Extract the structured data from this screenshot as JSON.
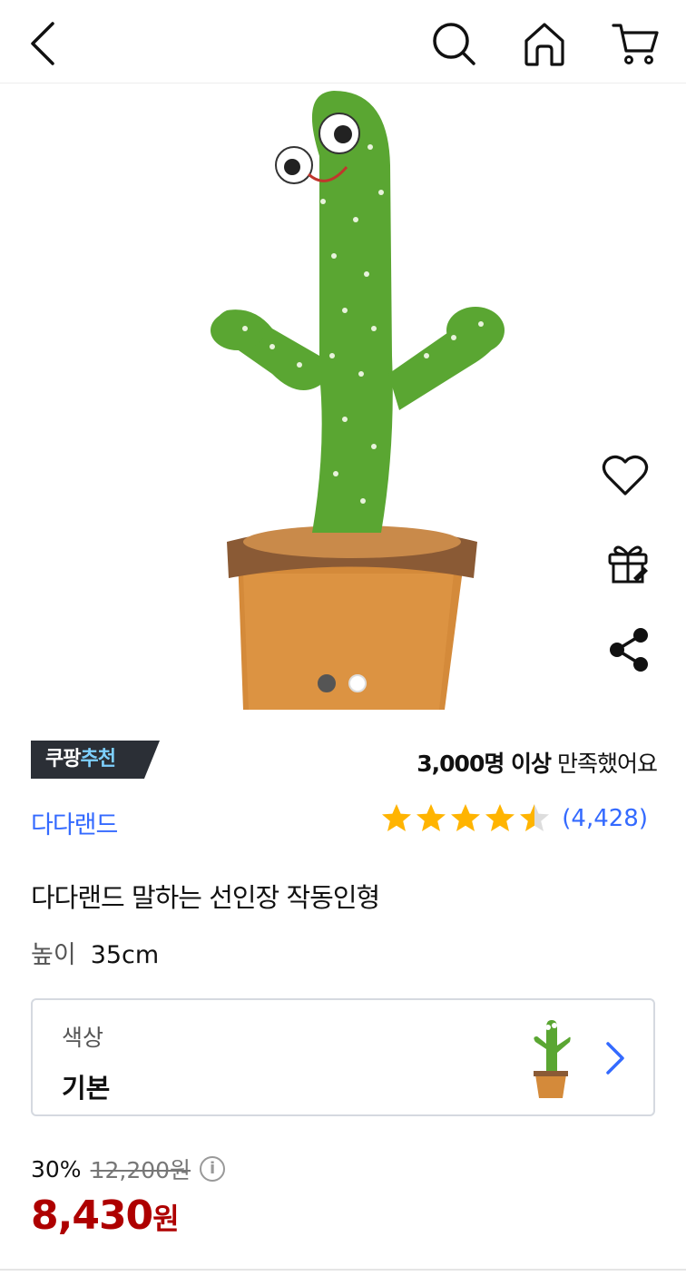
{
  "nav": {
    "icons": [
      "chevron-left-icon",
      "search-icon",
      "home-icon",
      "cart-icon"
    ]
  },
  "gallery": {
    "image": "dancing-cactus-plush-photo",
    "page_count": 2,
    "active_page": 1
  },
  "badge": {
    "part1": "쿠팡",
    "part2": "추천"
  },
  "satisfaction": {
    "strong": "3,000명 이상",
    "rest": " 만족했어요"
  },
  "brand": "다다랜드",
  "rating": {
    "stars": 4.5,
    "max": 5,
    "count": "(4,428)"
  },
  "product_title": "다다랜드 말하는 선인장 작동인형",
  "spec": {
    "key": "높이",
    "value": "35cm"
  },
  "option": {
    "label": "색상",
    "value": "기본"
  },
  "pricing": {
    "discount": "30%",
    "original": "12,200원",
    "price": "8,430",
    "unit": "원"
  },
  "colors": {
    "accent_blue": "#346aff",
    "price_red": "#ae0000",
    "badge_dark": "#2b2f36",
    "star": "#ffb400"
  }
}
